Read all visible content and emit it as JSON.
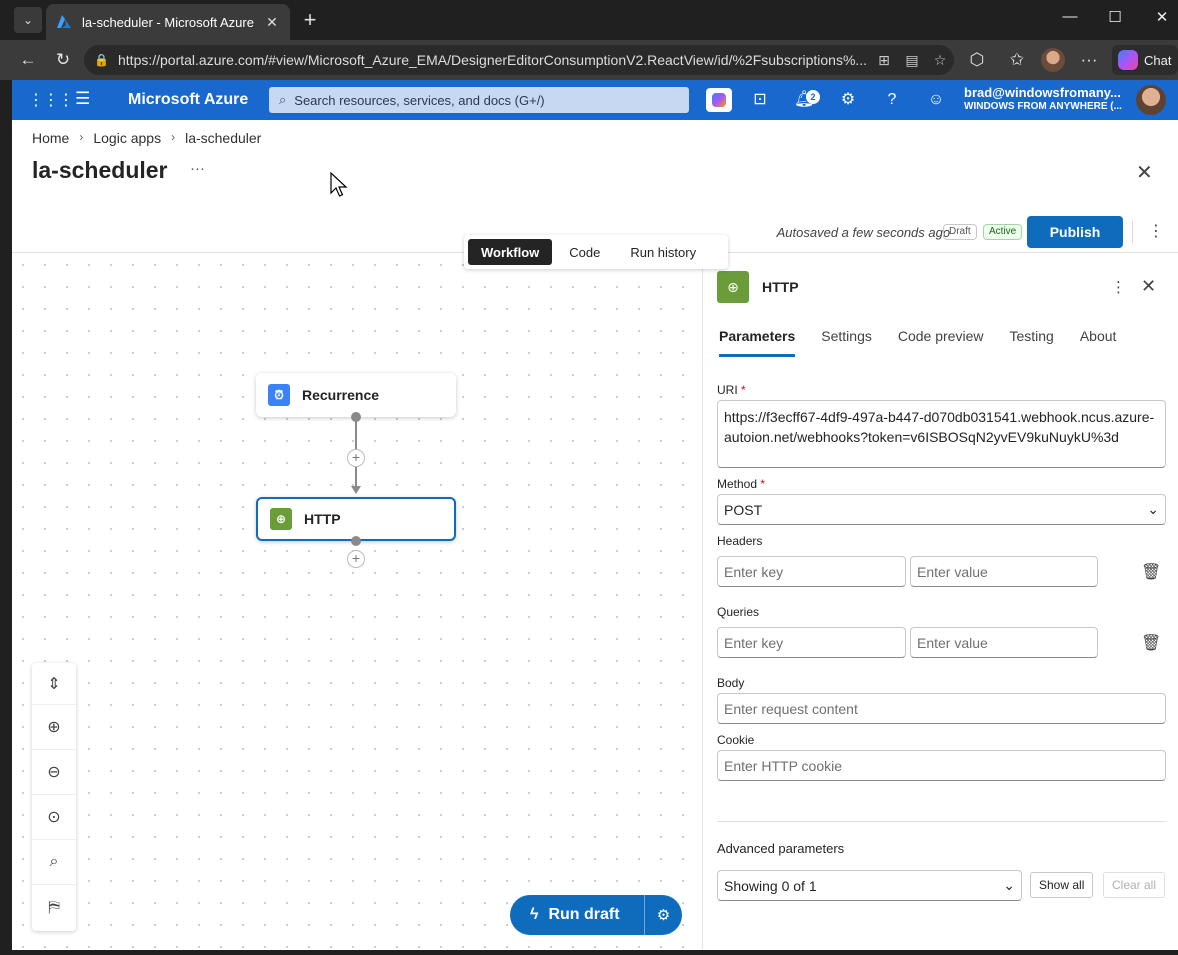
{
  "browser": {
    "tab_title": "la-scheduler - Microsoft Azure",
    "url": "https://portal.azure.com/#view/Microsoft_Azure_EMA/DesignerEditorConsumptionV2.ReactView/id/%2Fsubscriptions%...",
    "chat_label": "Chat"
  },
  "azure_header": {
    "brand": "Microsoft Azure",
    "search_placeholder": "Search resources, services, and docs (G+/)",
    "notification_count": "2",
    "user_email": "brad@windowsfromany...",
    "user_tenant": "WINDOWS FROM ANYWHERE (..."
  },
  "breadcrumb": [
    "Home",
    "Logic apps",
    "la-scheduler"
  ],
  "page_title": "la-scheduler",
  "command_bar": {
    "autosave": "Autosaved a few seconds ago",
    "draft_pill": "Draft",
    "active_pill": "Active",
    "publish_label": "Publish"
  },
  "view_tabs": [
    "Workflow",
    "Code",
    "Run history"
  ],
  "canvas": {
    "nodes": [
      {
        "label": "Recurrence",
        "icon": "clock-icon",
        "color": "#3b82f6"
      },
      {
        "label": "HTTP",
        "icon": "globe-icon",
        "color": "#6a9c3a"
      }
    ],
    "run_draft_label": "Run draft"
  },
  "panel": {
    "title": "HTTP",
    "tabs": [
      "Parameters",
      "Settings",
      "Code preview",
      "Testing",
      "About"
    ],
    "uri_label": "URI",
    "uri_value": "https://f3ecff67-4df9-497a-b447-d070db031541.webhook.ncus.azure-autoion.net/webhooks?token=v6ISBOSqN2yvEV9kuNuykU%3d",
    "method_label": "Method",
    "method_value": "POST",
    "headers_label": "Headers",
    "queries_label": "Queries",
    "key_placeholder": "Enter key",
    "value_placeholder": "Enter value",
    "body_label": "Body",
    "body_placeholder": "Enter request content",
    "cookie_label": "Cookie",
    "cookie_placeholder": "Enter HTTP cookie",
    "advanced_label": "Advanced parameters",
    "advanced_select": "Showing 0 of 1",
    "show_all": "Show all",
    "clear_all": "Clear all"
  }
}
